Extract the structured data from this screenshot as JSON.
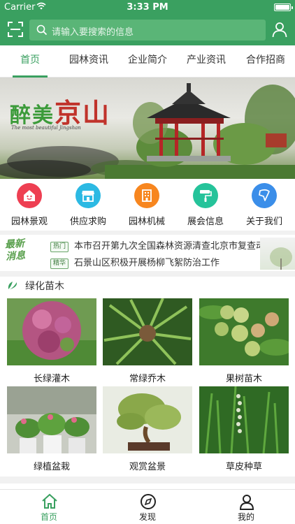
{
  "status_bar": {
    "carrier": "Carrier",
    "time": "3:33 PM"
  },
  "header": {
    "search_placeholder": "请输入要搜索的信息"
  },
  "tabs": [
    {
      "label": "首页",
      "active": true
    },
    {
      "label": "园林资讯",
      "active": false
    },
    {
      "label": "企业简介",
      "active": false
    },
    {
      "label": "产业资讯",
      "active": false
    },
    {
      "label": "合作招商",
      "active": false
    }
  ],
  "banner": {
    "title_a": "醉美",
    "title_b": "京山",
    "subtitle": "The most beautiful Jingshan"
  },
  "categories": [
    {
      "label": "园林景观",
      "icon": "smiley-house-icon",
      "color": "#ee3f52"
    },
    {
      "label": "供应求购",
      "icon": "store-icon",
      "color": "#2cb9e3"
    },
    {
      "label": "园林机械",
      "icon": "building-icon",
      "color": "#f7861f"
    },
    {
      "label": "展会信息",
      "icon": "paint-roller-icon",
      "color": "#25c39a"
    },
    {
      "label": "关于我们",
      "icon": "map-pin-icon",
      "color": "#3b8ee9"
    }
  ],
  "news": {
    "brand_line1": "最新",
    "brand_line2": "消息",
    "items": [
      {
        "tag": "热门",
        "text": "本市召开第九次全国森林资源清查北京市复查动员会"
      },
      {
        "tag": "精华",
        "text": "石景山区积极开展杨柳飞絮防治工作"
      }
    ]
  },
  "section": {
    "title": "绿化苗木"
  },
  "products": [
    {
      "label": "长绿灌木"
    },
    {
      "label": "常绿乔木"
    },
    {
      "label": "果树苗木"
    },
    {
      "label": "绿植盆栽"
    },
    {
      "label": "观赏盆景"
    },
    {
      "label": "草皮种草"
    }
  ],
  "bottom_nav": [
    {
      "label": "首页",
      "icon": "home-icon",
      "active": true
    },
    {
      "label": "发现",
      "icon": "compass-icon",
      "active": false
    },
    {
      "label": "我的",
      "icon": "user-icon",
      "active": false
    }
  ],
  "colors": {
    "brand_green": "#3aa060",
    "search_bg": "#5ab577"
  }
}
